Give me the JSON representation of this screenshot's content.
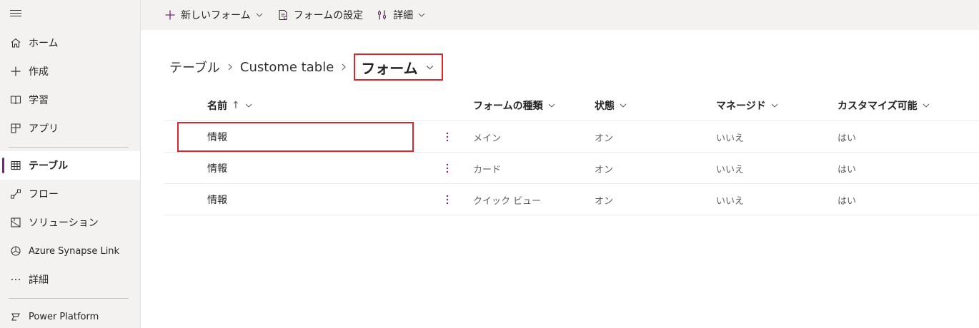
{
  "sidebar": {
    "items": [
      {
        "label": "ホーム",
        "icon": "home-icon"
      },
      {
        "label": "作成",
        "icon": "plus-icon"
      },
      {
        "label": "学習",
        "icon": "book-icon"
      },
      {
        "label": "アプリ",
        "icon": "apps-icon"
      },
      {
        "label": "テーブル",
        "icon": "table-icon",
        "active": true
      },
      {
        "label": "フロー",
        "icon": "flow-icon"
      },
      {
        "label": "ソリューション",
        "icon": "solution-icon"
      },
      {
        "label": "Azure Synapse Link",
        "icon": "synapse-icon"
      },
      {
        "label": "詳細",
        "icon": "more-icon"
      }
    ],
    "footer": {
      "label": "Power Platform",
      "icon": "power-platform-icon"
    }
  },
  "commandbar": {
    "new_form": "新しいフォーム",
    "form_settings": "フォームの設定",
    "details": "詳細"
  },
  "breadcrumb": {
    "items": [
      "テーブル",
      "Custome table"
    ],
    "current": "フォーム"
  },
  "table": {
    "columns": [
      "名前",
      "フォームの種類",
      "状態",
      "マネージド",
      "カスタマイズ可能"
    ],
    "sort_indicator": "↑",
    "rows": [
      {
        "name": "情報",
        "type": "メイン",
        "state": "オン",
        "managed": "いいえ",
        "customizable": "はい"
      },
      {
        "name": "情報",
        "type": "カード",
        "state": "オン",
        "managed": "いいえ",
        "customizable": "はい"
      },
      {
        "name": "情報",
        "type": "クイック ビュー",
        "state": "オン",
        "managed": "いいえ",
        "customizable": "はい"
      }
    ]
  },
  "colors": {
    "accent": "#742774",
    "highlight": "#d9262f"
  }
}
